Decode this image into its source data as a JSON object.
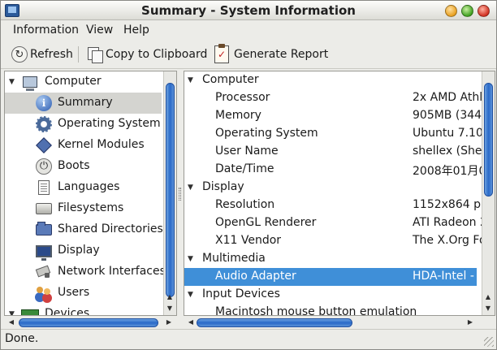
{
  "window": {
    "title": "Summary - System Information"
  },
  "menu": {
    "items": [
      "Information",
      "View",
      "Help"
    ]
  },
  "toolbar": {
    "refresh_label": "Refresh",
    "copy_label": "Copy to Clipboard",
    "report_label": "Generate Report"
  },
  "sidebar": {
    "root_label": "Computer",
    "items": [
      {
        "label": "Summary",
        "icon": "info-icon",
        "selected": true
      },
      {
        "label": "Operating System",
        "icon": "gear-icon"
      },
      {
        "label": "Kernel Modules",
        "icon": "kernel-icon"
      },
      {
        "label": "Boots",
        "icon": "power-icon"
      },
      {
        "label": "Languages",
        "icon": "document-icon"
      },
      {
        "label": "Filesystems",
        "icon": "drive-icon"
      },
      {
        "label": "Shared Directories",
        "icon": "folder-icon"
      },
      {
        "label": "Display",
        "icon": "monitor-icon"
      },
      {
        "label": "Network Interfaces",
        "icon": "network-icon"
      },
      {
        "label": "Users",
        "icon": "users-icon"
      }
    ],
    "devices_label": "Devices"
  },
  "details": {
    "sections": [
      {
        "title": "Computer",
        "rows": [
          {
            "key": "Processor",
            "value": "2x AMD Athl"
          },
          {
            "key": "Memory",
            "value": "905MB (344M"
          },
          {
            "key": "Operating System",
            "value": "Ubuntu 7.10"
          },
          {
            "key": "User Name",
            "value": "shellex (Shel"
          },
          {
            "key": "Date/Time",
            "value": "2008年01月06"
          }
        ]
      },
      {
        "title": "Display",
        "rows": [
          {
            "key": "Resolution",
            "value": "1152x864 pixe"
          },
          {
            "key": "OpenGL Renderer",
            "value": "ATI Radeon 2"
          },
          {
            "key": "X11 Vendor",
            "value": "The X.Org Fo"
          }
        ]
      },
      {
        "title": "Multimedia",
        "rows": [
          {
            "key": "Audio Adapter",
            "value": "HDA-Intel - H",
            "selected": true
          }
        ]
      },
      {
        "title": "Input Devices",
        "rows": [
          {
            "key": "Macintosh mouse button emulation",
            "value": ""
          }
        ]
      }
    ]
  },
  "status": {
    "text": "Done."
  },
  "colors": {
    "selection": "#3f8fd8",
    "scroll_thumb": "#2a6ac8"
  }
}
